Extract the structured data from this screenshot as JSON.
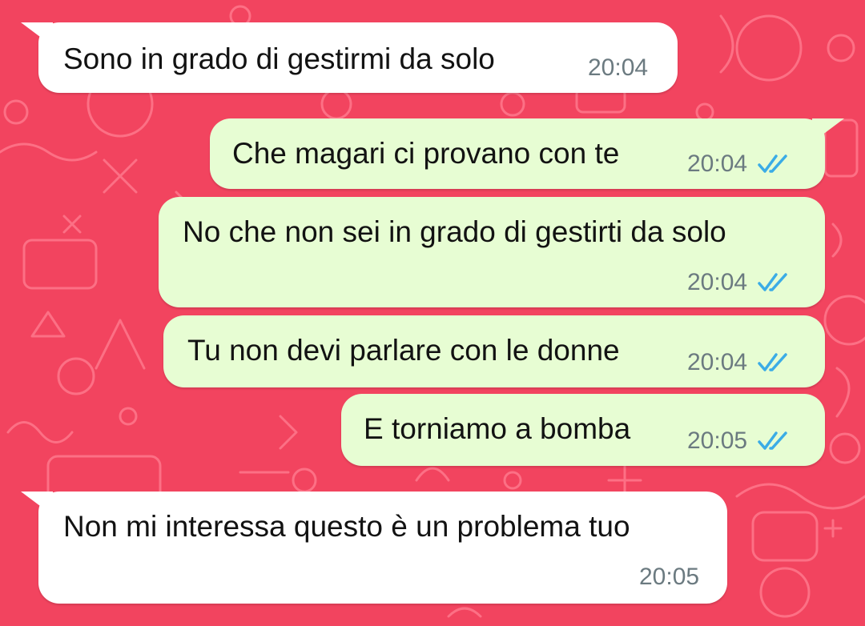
{
  "colors": {
    "wallpaper": "#f2445f",
    "incoming_bubble": "#ffffff",
    "outgoing_bubble": "#e7fdd3",
    "read_tick": "#3bace6",
    "timestamp": "#6b7a80"
  },
  "messages": [
    {
      "direction": "incoming",
      "text": "Sono in grado di gestirmi da solo",
      "time": "20:04",
      "status_icon": ""
    },
    {
      "direction": "outgoing",
      "text": "Che magari ci provano con te",
      "time": "20:04",
      "status_icon": "double-check-read-icon"
    },
    {
      "direction": "outgoing",
      "text": "No che non sei in grado di gestirti da solo",
      "time": "20:04",
      "status_icon": "double-check-read-icon"
    },
    {
      "direction": "outgoing",
      "text": "Tu non devi parlare con le donne",
      "time": "20:04",
      "status_icon": "double-check-read-icon"
    },
    {
      "direction": "outgoing",
      "text": "E torniamo a bomba",
      "time": "20:05",
      "status_icon": "double-check-read-icon"
    },
    {
      "direction": "incoming",
      "text": "Non mi interessa questo è un problema tuo",
      "time": "20:05",
      "status_icon": ""
    }
  ]
}
